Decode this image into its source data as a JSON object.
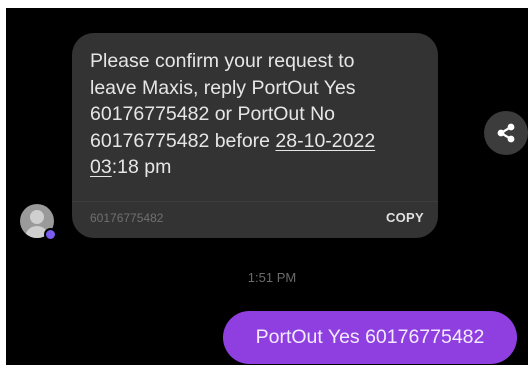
{
  "incoming_message": {
    "lines": [
      {
        "text": "Please confirm your request to"
      },
      {
        "text": "leave Maxis, reply PortOut Yes"
      },
      {
        "text": "60176775482 or PortOut No"
      },
      {
        "before": "60176775482 before ",
        "link": "28-10-2022"
      },
      {
        "link": "03",
        "after": ":18 pm"
      }
    ],
    "sender_number": "60176775482",
    "copy_label": "COPY"
  },
  "timestamp": "1:51 PM",
  "outgoing_message": {
    "text": "PortOut Yes 60176775482"
  },
  "colors": {
    "background": "#000000",
    "incoming_bubble": "#333333",
    "outgoing_bubble": "#8f3fe0",
    "avatar_badge": "#7b5cf0"
  },
  "icons": {
    "share": "share-icon",
    "avatar": "person-icon"
  }
}
